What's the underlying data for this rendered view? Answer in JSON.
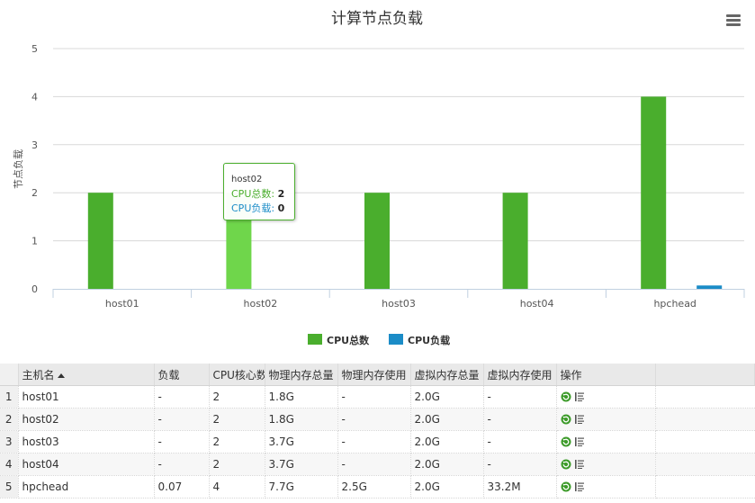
{
  "chart_data": {
    "type": "bar",
    "title": "计算节点负载",
    "ylabel": "节点负载",
    "xlabel": "",
    "categories": [
      "host01",
      "host02",
      "host03",
      "host04",
      "hpchead"
    ],
    "ylim": [
      0,
      5
    ],
    "yticks": [
      0,
      1,
      2,
      3,
      4,
      5
    ],
    "grid": true,
    "legend_position": "bottom",
    "series": [
      {
        "name": "CPU总数",
        "color": "#4aae2d",
        "values": [
          2,
          2,
          2,
          2,
          4
        ]
      },
      {
        "name": "CPU负载",
        "color": "#1b8cc7",
        "values": [
          0,
          0,
          0,
          0,
          0.07
        ]
      }
    ],
    "highlighted_category_index": 1,
    "highlight_color": "#6fd64b"
  },
  "tooltip": {
    "title": "host02",
    "line1_label": "CPU总数:",
    "line1_value": "2",
    "line2_label": "CPU负载:",
    "line2_value": "0"
  },
  "table": {
    "columns": [
      "主机名",
      "负载",
      "CPU核心数",
      "物理内存总量",
      "物理内存使用",
      "虚拟内存总量",
      "虚拟内存使用",
      "操作"
    ],
    "rows": [
      {
        "rn": "1",
        "host": "host01",
        "load": "-",
        "cpu": "2",
        "pmem_total": "1.8G",
        "pmem_used": "-",
        "vmem_total": "2.0G",
        "vmem_used": "-"
      },
      {
        "rn": "2",
        "host": "host02",
        "load": "-",
        "cpu": "2",
        "pmem_total": "1.8G",
        "pmem_used": "-",
        "vmem_total": "2.0G",
        "vmem_used": "-"
      },
      {
        "rn": "3",
        "host": "host03",
        "load": "-",
        "cpu": "2",
        "pmem_total": "3.7G",
        "pmem_used": "-",
        "vmem_total": "2.0G",
        "vmem_used": "-"
      },
      {
        "rn": "4",
        "host": "host04",
        "load": "-",
        "cpu": "2",
        "pmem_total": "3.7G",
        "pmem_used": "-",
        "vmem_total": "2.0G",
        "vmem_used": "-"
      },
      {
        "rn": "5",
        "host": "hpchead",
        "load": "0.07",
        "cpu": "4",
        "pmem_total": "7.7G",
        "pmem_used": "2.5G",
        "vmem_total": "2.0G",
        "vmem_used": "33.2M"
      }
    ],
    "icons": [
      "refresh-icon",
      "list-icon"
    ]
  }
}
